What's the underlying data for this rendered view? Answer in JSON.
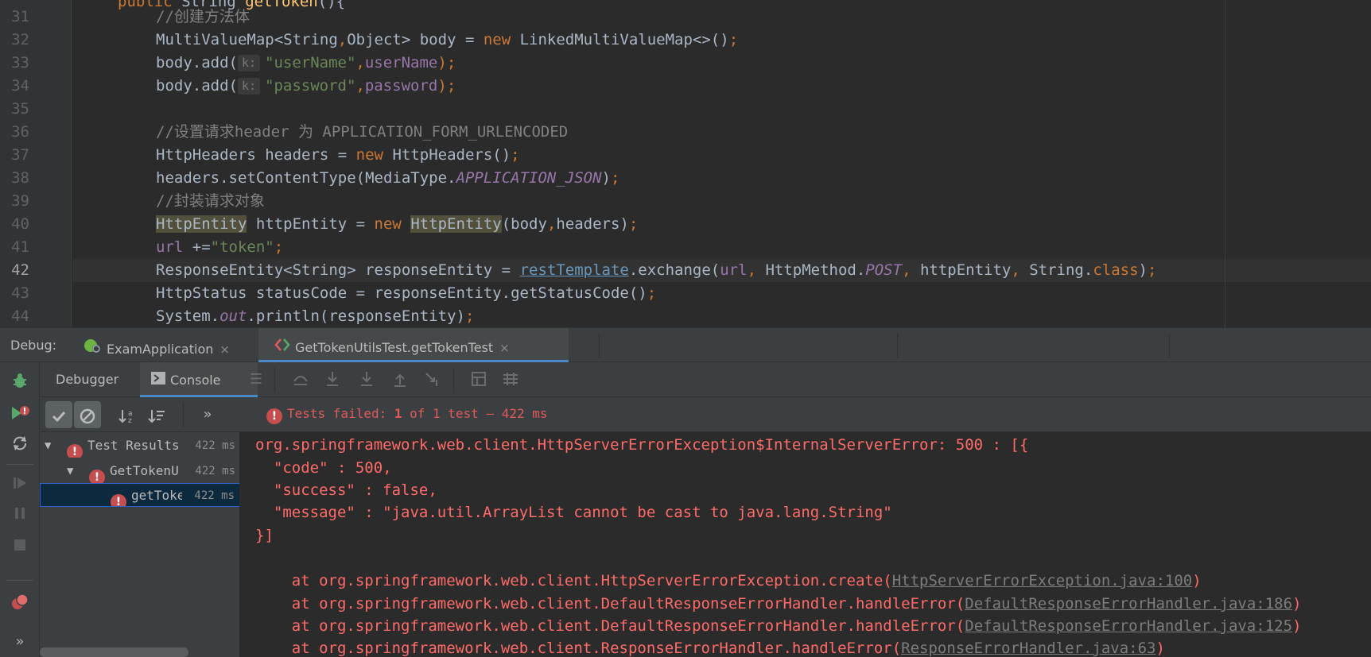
{
  "editor": {
    "line_numbers": [
      "31",
      "32",
      "33",
      "34",
      "35",
      "36",
      "37",
      "38",
      "39",
      "40",
      "41",
      "42",
      "43",
      "44"
    ],
    "current_line": "42",
    "code": {
      "l31_partial_kw": "public",
      "l31_partial_type": "String",
      "l31_partial_method": "getToken",
      "l31_rest": "(){",
      "l31_comment": "//创建方法体",
      "l32_a": "MultiValueMap<String",
      "l32_b": ",",
      "l32_c": "Object> body = ",
      "l32_d": "new ",
      "l32_e": "LinkedMultiValueMap<>()",
      "l32_f": ";",
      "l33_a": "body.add(",
      "hint_k": "k:",
      "l33_b": "\"userName\"",
      "l33_c": ",",
      "l33_d": "userName",
      "l33_e": ");",
      "l34_a": "body.add(",
      "l34_b": "\"password\"",
      "l34_c": ",",
      "l34_d": "password",
      "l34_e": ");",
      "l36_comment": "//设置请求header 为 APPLICATION_FORM_URLENCODED",
      "l37_a": "HttpHeaders headers = ",
      "l37_b": "new ",
      "l37_c": "HttpHeaders()",
      "l37_d": ";",
      "l38_a": "headers.setContentType(MediaType.",
      "l38_b": "APPLICATION_JSON",
      "l38_c": ")",
      "l38_d": ";",
      "l39_comment": "//封装请求对象",
      "l40_a": "HttpEntity",
      "l40_b": " httpEntity = ",
      "l40_c": "new ",
      "l40_d": "HttpEntity",
      "l40_e": "(body",
      "l40_f": ",",
      "l40_g": "headers)",
      "l40_h": ";",
      "l41_a": "url",
      "l41_b": " +=",
      "l41_c": "\"token\"",
      "l41_d": ";",
      "l42_a": "ResponseEntity<String> responseEntity = ",
      "l42_b": "restTemplate",
      "l42_c": ".exchange(",
      "l42_d": "url",
      "l42_e": ", ",
      "l42_f": "HttpMethod.",
      "l42_g": "POST",
      "l42_h": ", ",
      "l42_i": "httpEntity",
      "l42_j": ", ",
      "l42_k": "String.",
      "l42_l": "class",
      "l42_m": ")",
      "l42_n": ";",
      "l43_a": "HttpStatus statusCode = responseEntity.getStatusCode()",
      "l43_b": ";",
      "l44_a": "System.",
      "l44_b": "out",
      "l44_c": ".println(responseEntity)",
      "l44_d": ";"
    }
  },
  "debug_panel": {
    "label": "Debug:",
    "sessions": [
      {
        "label": "ExamApplication",
        "close": "×"
      },
      {
        "label": "GetTokenUtilsTest.getTokenTest",
        "close": "×"
      }
    ],
    "tabs": [
      {
        "label": "Debugger"
      },
      {
        "label": "Console"
      }
    ]
  },
  "test_status": {
    "prefix": "Tests failed: ",
    "failed": "1",
    "middle": " of ",
    "total": "1 test",
    "separator": " – ",
    "duration": "422 ms"
  },
  "test_tree": [
    {
      "label": "Test Results",
      "time": "422 ms"
    },
    {
      "label": "GetTokenU",
      "time": "422 ms"
    },
    {
      "label": "getToke",
      "time": "422 ms"
    }
  ],
  "console": {
    "lines": [
      "org.springframework.web.client.HttpServerErrorException$InternalServerError: 500 : [{",
      "  \"code\" : 500,",
      "  \"success\" : false,",
      "  \"message\" : \"java.util.ArrayList cannot be cast to java.lang.String\"",
      "}]"
    ],
    "stack": [
      {
        "prefix": "    at org.springframework.web.client.HttpServerErrorException.create(",
        "link": "HttpServerErrorException.java:100",
        "suffix": ")"
      },
      {
        "prefix": "    at org.springframework.web.client.DefaultResponseErrorHandler.handleError(",
        "link": "DefaultResponseErrorHandler.java:186",
        "suffix": ")"
      },
      {
        "prefix": "    at org.springframework.web.client.DefaultResponseErrorHandler.handleError(",
        "link": "DefaultResponseErrorHandler.java:125",
        "suffix": ")"
      },
      {
        "prefix": "    at org.springframework.web.client.ResponseErrorHandler.handleError(",
        "link": "ResponseErrorHandler.java:63",
        "suffix": ")"
      }
    ]
  },
  "icons": {
    "app_icon": "spring-boot-icon",
    "test_icon": "junit-icon",
    "console_icon": "console-icon"
  },
  "colors": {
    "error": "#ff6b68",
    "accent": "#4a88c7"
  }
}
